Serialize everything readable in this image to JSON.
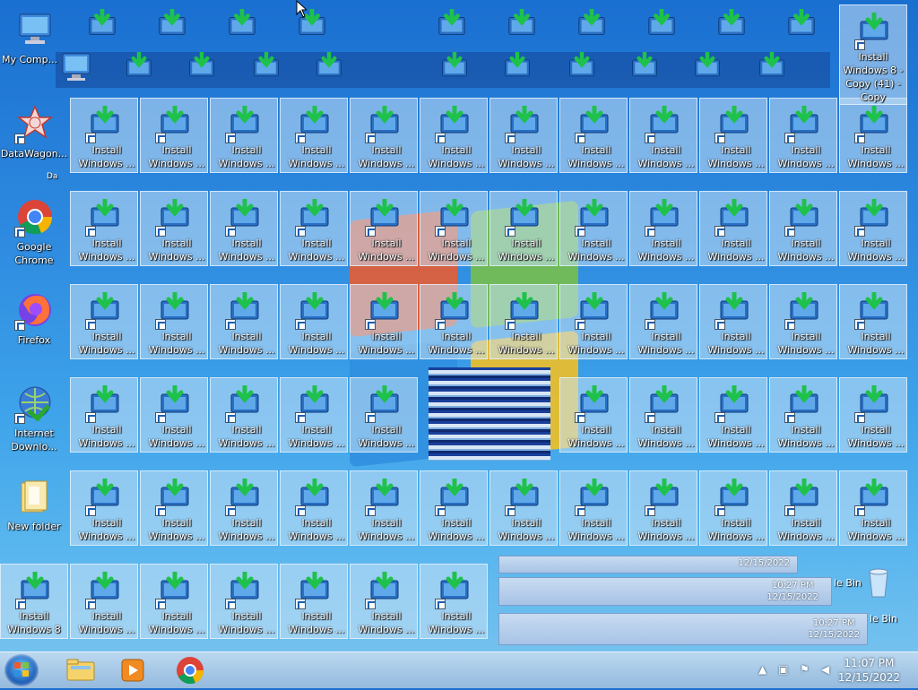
{
  "desktop": {
    "left_icons": [
      {
        "name": "my-computer",
        "label": "My Comp..."
      },
      {
        "name": "datawagon",
        "label": "DataWagon..."
      },
      {
        "name": "google-chrome",
        "label": "Google Chrome"
      },
      {
        "name": "firefox",
        "label": "Firefox"
      },
      {
        "name": "internet-download",
        "label": "Internet Downlo..."
      },
      {
        "name": "new-folder",
        "label": "New folder"
      }
    ],
    "install_label_short": "Install Windows ...",
    "install_label_row7_first": "Install Windows 8",
    "top_right_label": "Install Windows 8 - Copy (41) - Copy",
    "stray_text": "Da",
    "recycle_label_1": "le Bin",
    "recycle_label_2": "le Bin"
  },
  "ghost_clocks": [
    {
      "time": "",
      "date": "12/15/2022"
    },
    {
      "time": "10:27 PM",
      "date": "12/15/2022"
    },
    {
      "time": "10:27 PM",
      "date": "12/15/2022"
    }
  ],
  "taskbar": {
    "start_label": "Start",
    "pinned": [
      "Windows Explorer",
      "Windows Media Player",
      "Google Chrome"
    ],
    "tray_time": "11:07 PM",
    "tray_date": "12/15/2022"
  }
}
